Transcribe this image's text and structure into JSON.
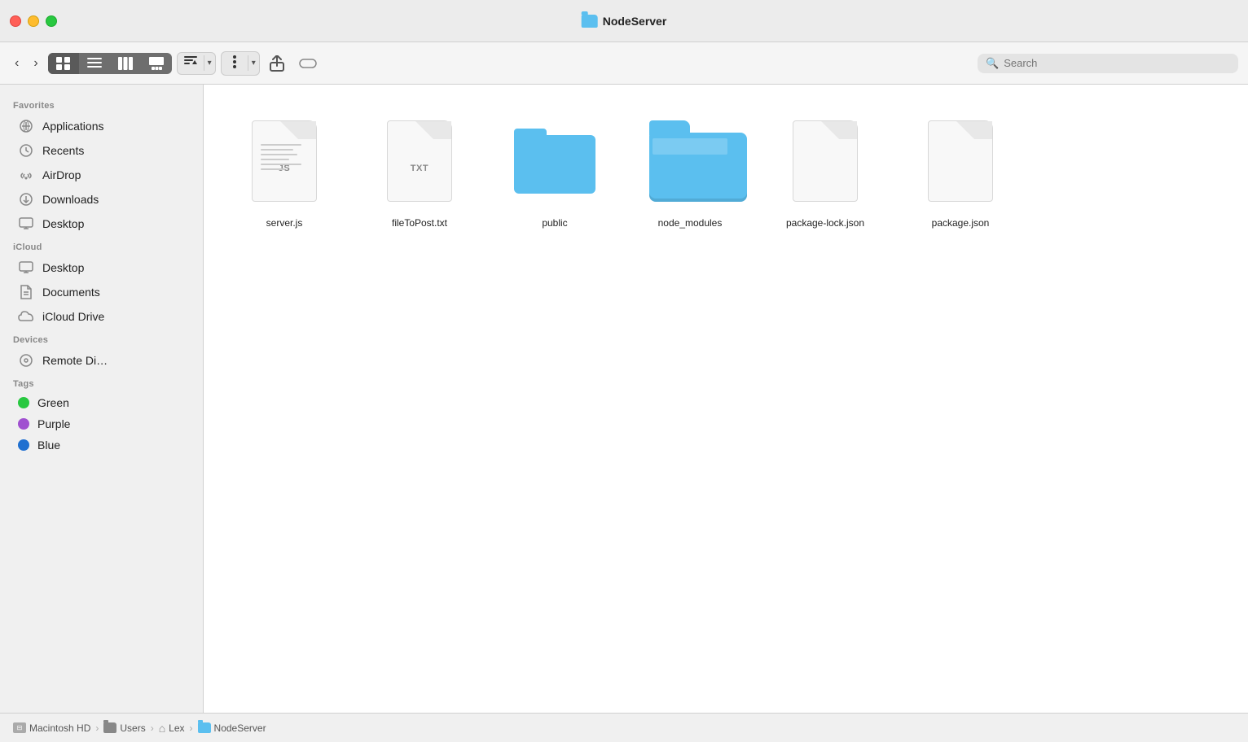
{
  "titlebar": {
    "title": "NodeServer",
    "traffic": {
      "close": "close",
      "minimize": "minimize",
      "maximize": "maximize"
    }
  },
  "toolbar": {
    "back_label": "‹",
    "forward_label": "›",
    "view_icon": "⊞",
    "view_list": "≡",
    "view_columns": "⊟",
    "view_gallery": "⊟⊟",
    "view_sort": "⊞",
    "action_btn": "⚙",
    "share_btn": "↑",
    "tag_btn": "⬭",
    "search_placeholder": "Search"
  },
  "sidebar": {
    "favorites_label": "Favorites",
    "icloud_label": "iCloud",
    "devices_label": "Devices",
    "tags_label": "Tags",
    "favorites_items": [
      {
        "id": "applications",
        "label": "Applications",
        "icon": "applications"
      },
      {
        "id": "recents",
        "label": "Recents",
        "icon": "recents"
      },
      {
        "id": "airdrop",
        "label": "AirDrop",
        "icon": "airdrop"
      },
      {
        "id": "downloads",
        "label": "Downloads",
        "icon": "downloads"
      },
      {
        "id": "desktop",
        "label": "Desktop",
        "icon": "desktop"
      }
    ],
    "icloud_items": [
      {
        "id": "icloud-desktop",
        "label": "Desktop",
        "icon": "desktop"
      },
      {
        "id": "icloud-documents",
        "label": "Documents",
        "icon": "documents"
      },
      {
        "id": "icloud-drive",
        "label": "iCloud Drive",
        "icon": "icloud"
      }
    ],
    "devices_items": [
      {
        "id": "remote-disk",
        "label": "Remote Di…",
        "icon": "disk"
      }
    ],
    "tags_items": [
      {
        "id": "tag-green",
        "label": "Green",
        "color": "#28c840"
      },
      {
        "id": "tag-purple",
        "label": "Purple",
        "color": "#a050d0"
      },
      {
        "id": "tag-blue",
        "label": "Blue",
        "color": "#2070d0"
      }
    ]
  },
  "files": [
    {
      "id": "server-js",
      "name": "server.js",
      "type": "js-doc",
      "badge": "JS"
    },
    {
      "id": "file-to-post-txt",
      "name": "fileToPost.txt",
      "type": "txt-doc",
      "badge": "TXT"
    },
    {
      "id": "public-folder",
      "name": "public",
      "type": "folder",
      "badge": ""
    },
    {
      "id": "node-modules-folder",
      "name": "node_modules",
      "type": "folder-large",
      "badge": ""
    },
    {
      "id": "package-lock-json",
      "name": "package-lock.json",
      "type": "doc",
      "badge": ""
    },
    {
      "id": "package-json",
      "name": "package.json",
      "type": "doc",
      "badge": ""
    }
  ],
  "statusbar": {
    "breadcrumbs": [
      {
        "label": "Macintosh HD",
        "type": "hd"
      },
      {
        "label": "Users",
        "type": "folder"
      },
      {
        "label": "Lex",
        "type": "home"
      },
      {
        "label": "NodeServer",
        "type": "folder-blue"
      }
    ]
  }
}
